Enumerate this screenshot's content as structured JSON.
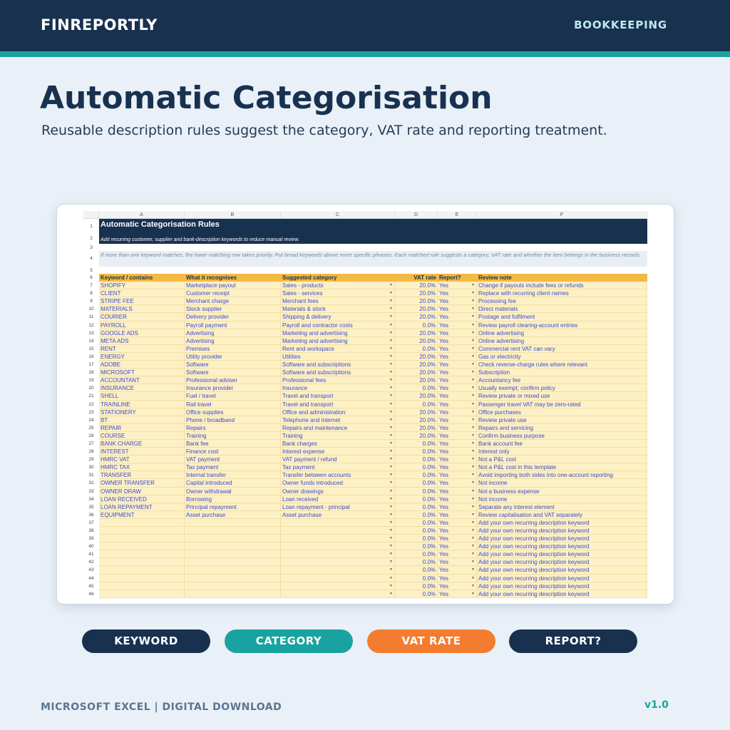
{
  "brand": "FINREPORTLY",
  "nav_tag": "BOOKKEEPING",
  "title": "Automatic Categorisation",
  "subtitle": "Reusable description rules suggest the category, VAT rate and reporting treatment.",
  "sheet": {
    "column_letters": [
      "A",
      "B",
      "C",
      "D",
      "E",
      "F"
    ],
    "title": "Automatic Categorisation Rules",
    "subtitle": "Add recurring customer, supplier and bank-description keywords to reduce manual review.",
    "note": "If more than one keyword matches, the lower matching row takes priority. Put broad keywords above more specific phrases. Each matched rule suggests a category, VAT rate and whether the item belongs in the business records.",
    "headers": [
      "Keyword / contains",
      "What it recognises",
      "Suggested category",
      "VAT rate",
      "Report?",
      "Review note"
    ],
    "rows": [
      [
        "SHOPIFY",
        "Marketplace payout",
        "Sales - products",
        "20.0%",
        "Yes",
        "Change if payouts include fees or refunds"
      ],
      [
        "CLIENT",
        "Customer receipt",
        "Sales - services",
        "20.0%",
        "Yes",
        "Replace with recurring client names"
      ],
      [
        "STRIPE FEE",
        "Merchant charge",
        "Merchant fees",
        "20.0%",
        "Yes",
        "Processing fee"
      ],
      [
        "MATERIALS",
        "Stock supplier",
        "Materials & stock",
        "20.0%",
        "Yes",
        "Direct materials"
      ],
      [
        "COURIER",
        "Delivery provider",
        "Shipping & delivery",
        "20.0%",
        "Yes",
        "Postage and fulfilment"
      ],
      [
        "PAYROLL",
        "Payroll payment",
        "Payroll and contractor costs",
        "0.0%",
        "Yes",
        "Review payroll clearing-account entries"
      ],
      [
        "GOOGLE ADS",
        "Advertising",
        "Marketing and advertising",
        "20.0%",
        "Yes",
        "Online advertising"
      ],
      [
        "META ADS",
        "Advertising",
        "Marketing and advertising",
        "20.0%",
        "Yes",
        "Online advertising"
      ],
      [
        "RENT",
        "Premises",
        "Rent and workspace",
        "0.0%",
        "Yes",
        "Commercial rent VAT can vary"
      ],
      [
        "ENERGY",
        "Utility provider",
        "Utilities",
        "20.0%",
        "Yes",
        "Gas or electricity"
      ],
      [
        "ADOBE",
        "Software",
        "Software and subscriptions",
        "20.0%",
        "Yes",
        "Check reverse-charge rules where relevant"
      ],
      [
        "MICROSOFT",
        "Software",
        "Software and subscriptions",
        "20.0%",
        "Yes",
        "Subscription"
      ],
      [
        "ACCOUNTANT",
        "Professional adviser",
        "Professional fees",
        "20.0%",
        "Yes",
        "Accountancy fee"
      ],
      [
        "INSURANCE",
        "Insurance provider",
        "Insurance",
        "0.0%",
        "Yes",
        "Usually exempt; confirm policy"
      ],
      [
        "SHELL",
        "Fuel / travel",
        "Travel and transport",
        "20.0%",
        "Yes",
        "Review private or mixed use"
      ],
      [
        "TRAINLINE",
        "Rail travel",
        "Travel and transport",
        "0.0%",
        "Yes",
        "Passenger travel VAT may be zero-rated"
      ],
      [
        "STATIONERY",
        "Office supplies",
        "Office and administration",
        "20.0%",
        "Yes",
        "Office purchases"
      ],
      [
        "BT",
        "Phone / broadband",
        "Telephone and internet",
        "20.0%",
        "Yes",
        "Review private use"
      ],
      [
        "REPAIR",
        "Repairs",
        "Repairs and maintenance",
        "20.0%",
        "Yes",
        "Repairs and servicing"
      ],
      [
        "COURSE",
        "Training",
        "Training",
        "20.0%",
        "Yes",
        "Confirm business purpose"
      ],
      [
        "BANK CHARGE",
        "Bank fee",
        "Bank charges",
        "0.0%",
        "Yes",
        "Bank account fee"
      ],
      [
        "INTEREST",
        "Finance cost",
        "Interest expense",
        "0.0%",
        "Yes",
        "Interest only"
      ],
      [
        "HMRC VAT",
        "VAT payment",
        "VAT payment / refund",
        "0.0%",
        "Yes",
        "Not a P&L cost"
      ],
      [
        "HMRC TAX",
        "Tax payment",
        "Tax payment",
        "0.0%",
        "Yes",
        "Not a P&L cost in this template"
      ],
      [
        "TRANSFER",
        "Internal transfer",
        "Transfer between accounts",
        "0.0%",
        "Yes",
        "Avoid importing both sides into one-account reporting"
      ],
      [
        "OWNER TRANSFER",
        "Capital introduced",
        "Owner funds introduced",
        "0.0%",
        "Yes",
        "Not income"
      ],
      [
        "OWNER DRAW",
        "Owner withdrawal",
        "Owner drawings",
        "0.0%",
        "Yes",
        "Not a business expense"
      ],
      [
        "LOAN RECEIVED",
        "Borrowing",
        "Loan received",
        "0.0%",
        "Yes",
        "Not income"
      ],
      [
        "LOAN REPAYMENT",
        "Principal repayment",
        "Loan repayment - principal",
        "0.0%",
        "Yes",
        "Separate any interest element"
      ],
      [
        "EQUIPMENT",
        "Asset purchase",
        "Asset purchase",
        "0.0%",
        "Yes",
        "Review capitalisation and VAT separately"
      ],
      [
        "",
        "",
        "",
        "0.0%",
        "Yes",
        "Add your own recurring description keyword"
      ],
      [
        "",
        "",
        "",
        "0.0%",
        "Yes",
        "Add your own recurring description keyword"
      ],
      [
        "",
        "",
        "",
        "0.0%",
        "Yes",
        "Add your own recurring description keyword"
      ],
      [
        "",
        "",
        "",
        "0.0%",
        "Yes",
        "Add your own recurring description keyword"
      ],
      [
        "",
        "",
        "",
        "0.0%",
        "Yes",
        "Add your own recurring description keyword"
      ],
      [
        "",
        "",
        "",
        "0.0%",
        "Yes",
        "Add your own recurring description keyword"
      ],
      [
        "",
        "",
        "",
        "0.0%",
        "Yes",
        "Add your own recurring description keyword"
      ],
      [
        "",
        "",
        "",
        "0.0%",
        "Yes",
        "Add your own recurring description keyword"
      ],
      [
        "",
        "",
        "",
        "0.0%",
        "Yes",
        "Add your own recurring description keyword"
      ],
      [
        "",
        "",
        "",
        "0.0%",
        "Yes",
        "Add your own recurring description keyword"
      ]
    ]
  },
  "pills": [
    "KEYWORD",
    "CATEGORY",
    "VAT RATE",
    "REPORT?"
  ],
  "footer_left": "MICROSOFT EXCEL | DIGITAL DOWNLOAD",
  "footer_right": "v1.0"
}
